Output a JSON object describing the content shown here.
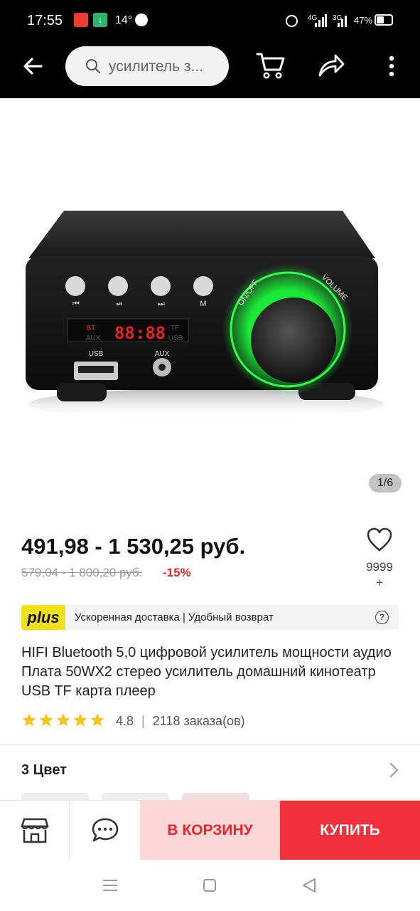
{
  "status": {
    "time": "17:55",
    "temperature": "14°",
    "net1": "4G",
    "net2": "3G",
    "battery": "47%"
  },
  "search": {
    "placeholder": "усилитель з..."
  },
  "gallery": {
    "counter": "1/6"
  },
  "device_labels": {
    "usb": "USB",
    "aux": "AUX",
    "bt": "BT",
    "tf": "TF",
    "usb2": "USB",
    "aux2": "AUX",
    "display": "88:88",
    "btn_m": "M",
    "on_off": "ON/OFF",
    "volume": "VOLUME"
  },
  "price": {
    "current": "491,98 - 1 530,25 руб.",
    "old": "579,04 - 1 800,20 руб.",
    "discount": "-15%"
  },
  "favorites": {
    "count_line1": "9999",
    "count_line2": "+"
  },
  "plus": {
    "badge": "plus",
    "text": "Ускоренная доставка | Удобный возврат"
  },
  "product": {
    "title": "HIFI Bluetooth 5,0 цифровой усилитель мощности аудио Плата 50WX2 стерео усилитель домашний кинотеатр USB TF карта плеер",
    "rating": "4.8",
    "orders": "2118 заказа(ов)",
    "stars": 5
  },
  "variants": {
    "label": "3 Цвет"
  },
  "bottom_bar": {
    "cart": "В КОРЗИНУ",
    "buy": "КУПИТЬ"
  },
  "colors": {
    "accent": "#f0303a",
    "accent_light": "#fcd7d7",
    "star": "#f5c518",
    "plus_badge": "#f0e11a"
  }
}
